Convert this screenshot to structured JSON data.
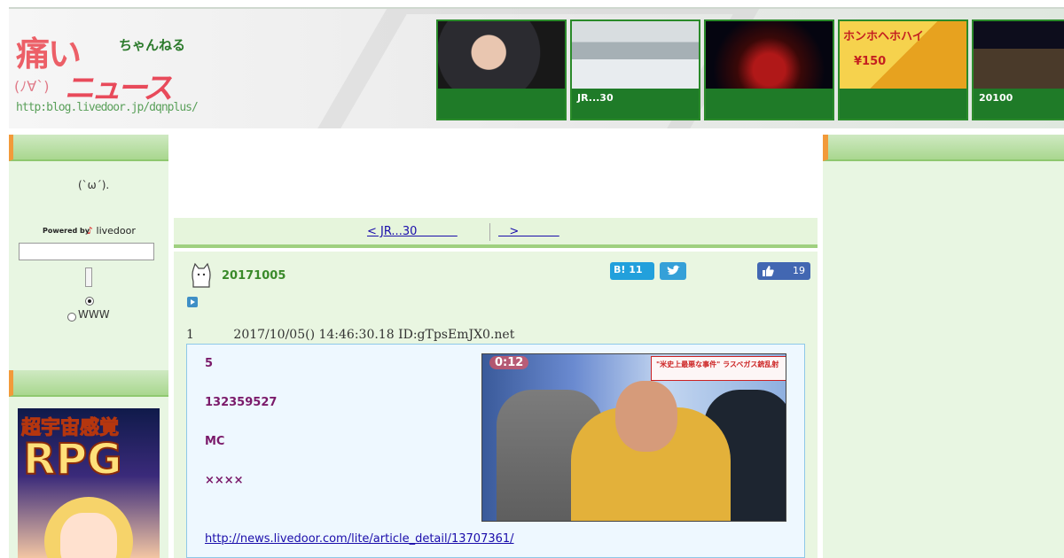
{
  "site": {
    "logo_main": "痛い",
    "logo_chan": "ちゃんねる",
    "logo_sub": "ニュース",
    "logo_face": "(ﾉ∀`)",
    "logo_url": "http:blog.livedoor.jp/dqnplus/"
  },
  "thumbnails": [
    {
      "caption": ""
    },
    {
      "caption": "JR...30"
    },
    {
      "caption": ""
    },
    {
      "caption": "",
      "ad_text": "ホンホヘホハイ",
      "price": "¥150"
    },
    {
      "caption": "20100"
    }
  ],
  "sidebar": {
    "face_icon": "(`ω´).",
    "powered_by": "Powered by",
    "livedoor": "livedoor",
    "radio_www": "WWW",
    "ad_line1": "超宇宙感覚",
    "ad_line2": "RPG"
  },
  "nav": {
    "prev": "< JR...30           ",
    "next": "   >           "
  },
  "article": {
    "date": "20171005",
    "hatena_label": "B! 11",
    "like_count": "19",
    "post_header": "1          2017/10/05() 14:46:30.18 ID:gTpsEmJX0.net",
    "lines": [
      "5",
      "132359527",
      "MC",
      "××××"
    ],
    "source_link": "http://news.livedoor.com/lite/article_detail/13707361/",
    "tv_timer": "0:12",
    "tv_caption": "\"米史上最悪な事件\" ラスベガス銃乱射"
  },
  "colors": {
    "accent_green": "#2a8a2a",
    "link_blue": "#1a0dab",
    "post_purple": "#7a1a6a"
  },
  "icons": [
    "cat-icon",
    "twitter-icon",
    "thumbs-up-icon",
    "play-icon"
  ]
}
